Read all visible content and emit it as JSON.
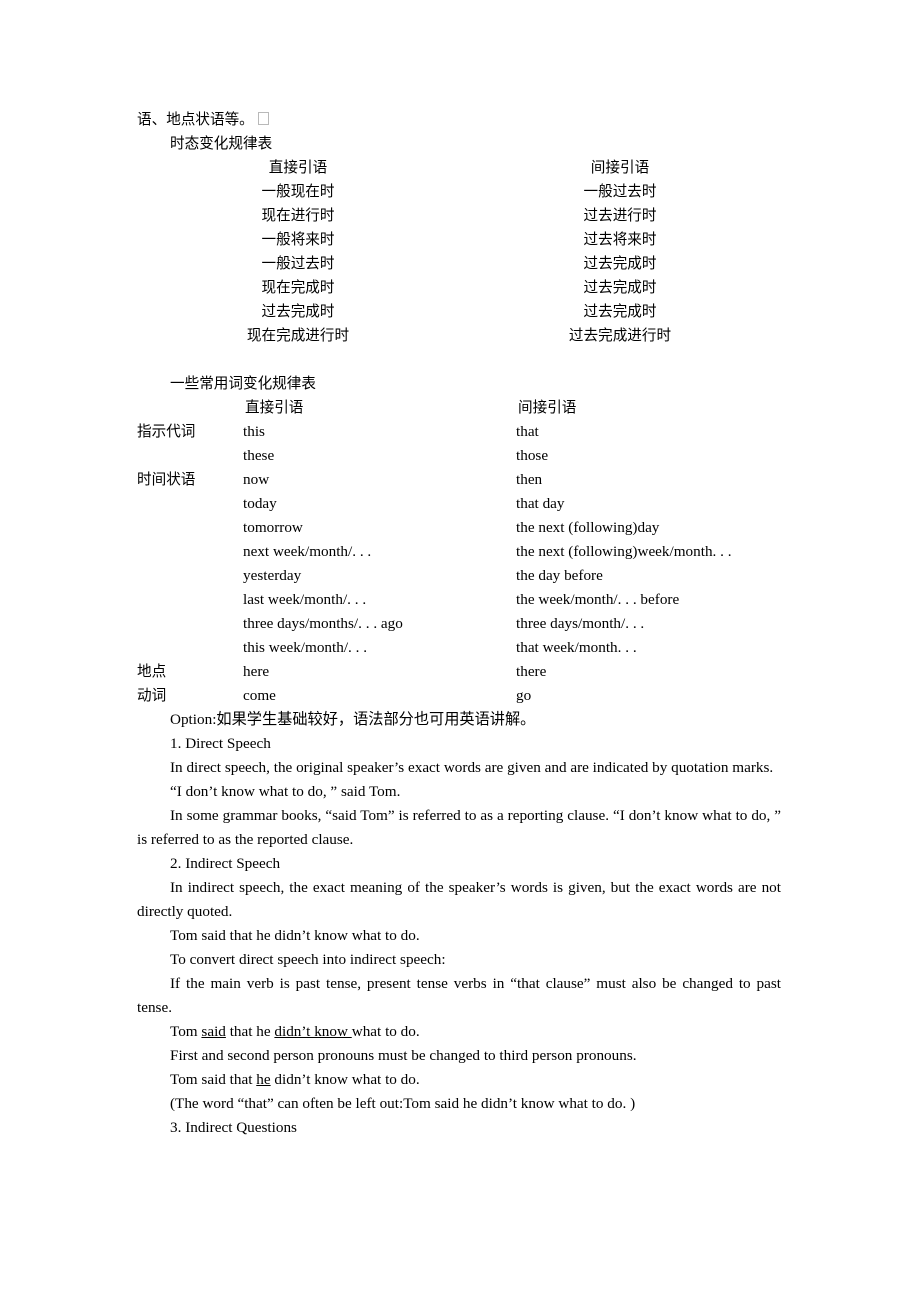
{
  "document": {
    "language_note": "Chinese-English grammar teaching notes on direct and indirect speech",
    "first_line": "语、地点状语等。",
    "tense_table": {
      "heading": "时态变化规律表",
      "columns": [
        "直接引语",
        "间接引语"
      ],
      "rows": [
        [
          "一般现在时",
          "一般过去时"
        ],
        [
          "现在进行时",
          "过去进行时"
        ],
        [
          "一般将来时",
          "过去将来时"
        ],
        [
          "一般过去时",
          "过去完成时"
        ],
        [
          "现在完成时",
          "过去完成时"
        ],
        [
          "过去完成时",
          "过去完成时"
        ],
        [
          "现在完成进行时",
          "过去完成进行时"
        ]
      ]
    },
    "word_table": {
      "heading": "一些常用词变化规律表",
      "columns": [
        "直接引语",
        "间接引语"
      ],
      "rows": [
        {
          "label": "指示代词",
          "direct": "this",
          "indirect": "that"
        },
        {
          "label": "",
          "direct": "these",
          "indirect": "those"
        },
        {
          "label": "时间状语",
          "direct": "now",
          "indirect": "then"
        },
        {
          "label": "",
          "direct": "today",
          "indirect": "that day"
        },
        {
          "label": "",
          "direct": "tomorrow",
          "indirect": "the next (following)day"
        },
        {
          "label": "",
          "direct": "next week/month/. . .",
          "indirect": "the next (following)week/month. . ."
        },
        {
          "label": "",
          "direct": "yesterday",
          "indirect": "the day before"
        },
        {
          "label": "",
          "direct": "last week/month/. . .",
          "indirect": "the week/month/. . . before"
        },
        {
          "label": "",
          "direct": "three days/months/. . . ago",
          "indirect": "three days/month/. . ."
        },
        {
          "label": "",
          "direct": "this week/month/. . .",
          "indirect": "that week/month. . ."
        },
        {
          "label": "地点",
          "direct": "here",
          "indirect": "there"
        },
        {
          "label": "动词",
          "direct": "come",
          "indirect": "go"
        }
      ]
    },
    "option_line": "Option:如果学生基础较好，语法部分也可用英语讲解。",
    "sections": {
      "s1_heading": "1. Direct Speech",
      "s1_p1": "In direct speech, the original speaker’s exact words are given and are indicated by quotation marks.",
      "s1_p2": "“I don’t know what to do, ” said Tom.",
      "s1_p3": "In some grammar books, “said Tom” is referred to as a reporting clause. “I don’t know what to do, ” is referred to as the reported clause.",
      "s2_heading": "2. Indirect Speech",
      "s2_p1": "In indirect speech, the exact meaning of the speaker’s words is given, but the exact words are not directly quoted.",
      "s2_p2": "Tom said that he didn’t know what to do.",
      "s2_p3": "To convert direct speech into indirect speech:",
      "s2_p4": "If the main verb is past tense, present tense verbs in “that clause” must also be changed to past tense.",
      "s2_example1": {
        "before": "Tom ",
        "underline1": "said",
        "middle": " that he ",
        "underline2": "didn’t know ",
        "after": "what to do."
      },
      "s2_p5": "First and second person pronouns must be changed to third person pronouns.",
      "s2_example2": {
        "before": "Tom said that ",
        "underline1": "he",
        "after": " didn’t know what to do."
      },
      "s2_p6": "(The word “that” can often be left out:Tom said he didn’t know what to do. )",
      "s3_heading": "3. Indirect Questions"
    }
  }
}
